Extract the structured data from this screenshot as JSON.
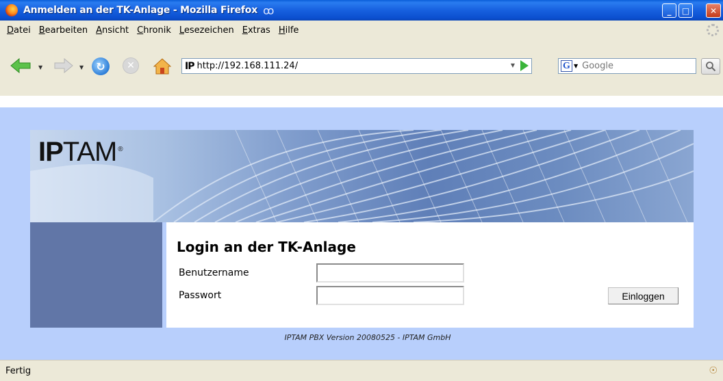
{
  "window": {
    "title": "Anmelden an der TK-Anlage - Mozilla Firefox",
    "controls": {
      "minimize": "_",
      "maximize": "□",
      "close": "✕"
    }
  },
  "menu": {
    "items": [
      "Datei",
      "Bearbeiten",
      "Ansicht",
      "Chronik",
      "Lesezeichen",
      "Extras",
      "Hilfe"
    ]
  },
  "toolbar": {
    "icons": [
      "back-arrow",
      "forward-arrow",
      "reload",
      "stop",
      "home"
    ],
    "url": "http://192.168.111.24/",
    "favicon": "IP",
    "search_engine_icon": "G",
    "search_placeholder": "Google"
  },
  "page": {
    "logo_text_bold": "IP",
    "logo_text": "TAM",
    "logo_mark": "®",
    "login_title": "Login an der TK-Anlage",
    "username_label": "Benutzername",
    "username_value": "",
    "password_label": "Passwort",
    "password_value": "",
    "login_button": "Einloggen",
    "footer": "IPTAM PBX Version 20080525 - IPTAM GmbH"
  },
  "status": {
    "text": "Fertig"
  },
  "colors": {
    "titlebar": "#1760df",
    "page_background": "#b8cffc",
    "sidebar": "#6176a7",
    "panel": "#ffffff"
  }
}
